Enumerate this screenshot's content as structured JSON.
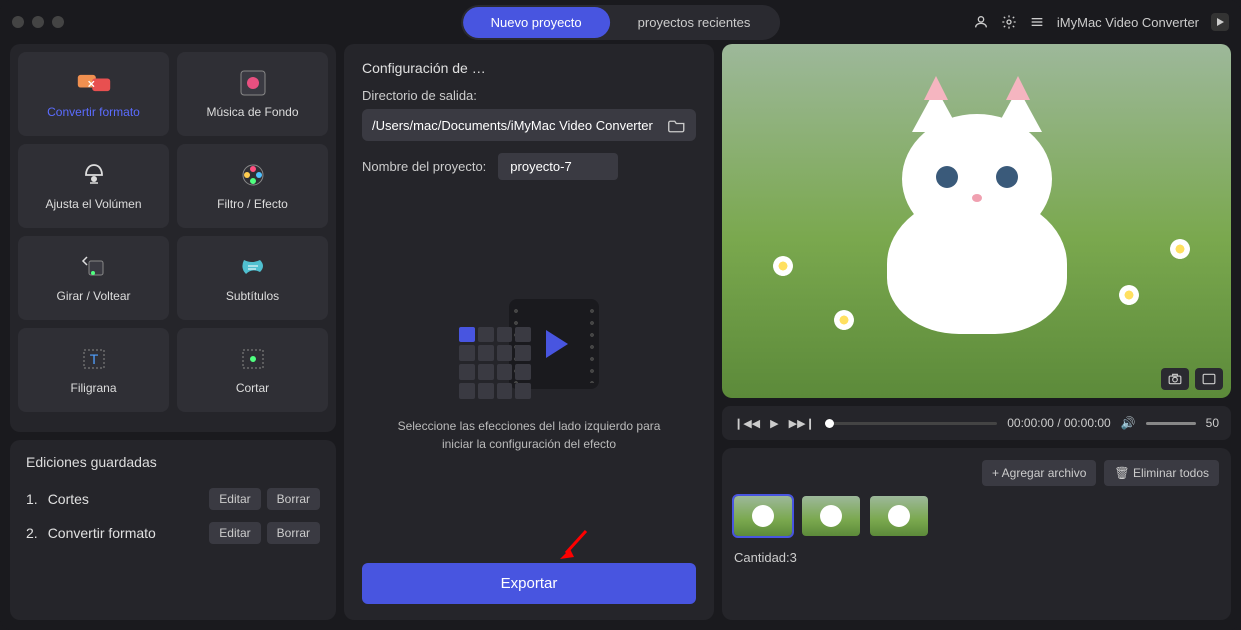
{
  "header": {
    "new_project": "Nuevo proyecto",
    "recent_projects": "proyectos recientes",
    "app_name": "iMyMac Video Converter"
  },
  "tools": [
    {
      "label": "Convertir formato",
      "active": true
    },
    {
      "label": "Música de Fondo",
      "active": false
    },
    {
      "label": "Ajusta el Volúmen",
      "active": false
    },
    {
      "label": "Filtro / Efecto",
      "active": false
    },
    {
      "label": "Girar / Voltear",
      "active": false
    },
    {
      "label": "Subtítulos",
      "active": false
    },
    {
      "label": "Filigrana",
      "active": false
    },
    {
      "label": "Cortar",
      "active": false
    }
  ],
  "saved": {
    "title": "Ediciones guardadas",
    "items": [
      {
        "num": "1.",
        "name": "Cortes"
      },
      {
        "num": "2.",
        "name": "Convertir formato"
      }
    ],
    "edit": "Editar",
    "delete": "Borrar"
  },
  "config": {
    "title": "Configuración de …",
    "dir_label": "Directorio de salida:",
    "dir_value": "/Users/mac/Documents/iMyMac Video Converter",
    "name_label": "Nombre del proyecto:",
    "name_value": "proyecto-7",
    "hint": "Seleccione las efecciones del lado izquierdo para iniciar la configuración del efecto",
    "export": "Exportar"
  },
  "transport": {
    "time": "00:00:00 / 00:00:00",
    "volume": "50"
  },
  "clips": {
    "add": "Agregar archivo",
    "remove": "Eliminar todos",
    "count_label": "Cantidad:3",
    "count": 3
  }
}
